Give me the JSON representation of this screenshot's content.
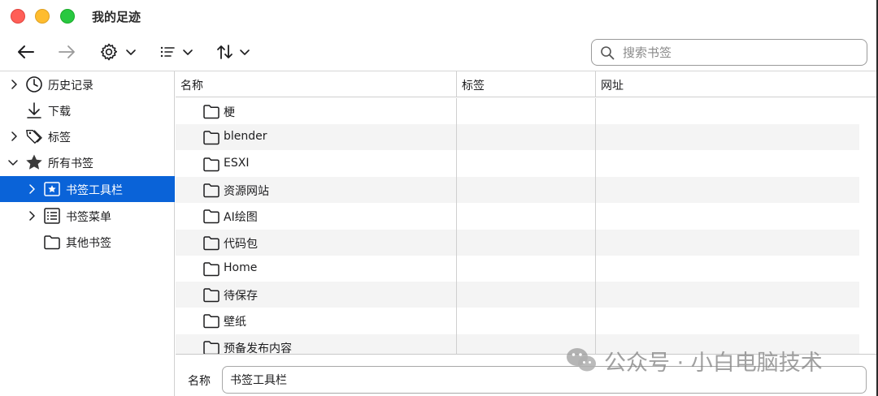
{
  "window": {
    "title": "我的足迹"
  },
  "toolbar": {
    "back_icon": "arrow-left-icon",
    "forward_icon": "arrow-right-icon",
    "organize_icon": "gear-icon",
    "views_icon": "list-icon",
    "sort_icon": "sort-arrows-icon",
    "search_placeholder": "搜索书签"
  },
  "sidebar": {
    "items": [
      {
        "label": "历史记录",
        "icon": "clock-icon",
        "expandable": true,
        "expanded": false,
        "level": 0
      },
      {
        "label": "下载",
        "icon": "download-icon",
        "expandable": false,
        "level": 0
      },
      {
        "label": "标签",
        "icon": "tags-icon",
        "expandable": true,
        "expanded": false,
        "level": 0
      },
      {
        "label": "所有书签",
        "icon": "star-icon",
        "expandable": true,
        "expanded": true,
        "level": 0
      },
      {
        "label": "书签工具栏",
        "icon": "bookmarks-toolbar-icon",
        "expandable": true,
        "expanded": false,
        "level": 1,
        "selected": true
      },
      {
        "label": "书签菜单",
        "icon": "bookmarks-menu-icon",
        "expandable": true,
        "expanded": false,
        "level": 1
      },
      {
        "label": "其他书签",
        "icon": "folder-icon",
        "expandable": false,
        "level": 1
      }
    ]
  },
  "list": {
    "columns": [
      "名称",
      "标签",
      "网址"
    ],
    "rows": [
      {
        "name": "梗",
        "tags": "",
        "url": ""
      },
      {
        "name": "blender",
        "tags": "",
        "url": ""
      },
      {
        "name": "ESXI",
        "tags": "",
        "url": ""
      },
      {
        "name": "资源网站",
        "tags": "",
        "url": ""
      },
      {
        "name": "AI绘图",
        "tags": "",
        "url": ""
      },
      {
        "name": "代码包",
        "tags": "",
        "url": ""
      },
      {
        "name": "Home",
        "tags": "",
        "url": ""
      },
      {
        "name": "待保存",
        "tags": "",
        "url": ""
      },
      {
        "name": "壁纸",
        "tags": "",
        "url": ""
      },
      {
        "name": "预备发布内容",
        "tags": "",
        "url": ""
      }
    ]
  },
  "detail": {
    "name_label": "名称",
    "name_value": "书签工具栏"
  },
  "watermark": {
    "text": "公众号 · 小白电脑技术"
  },
  "colors": {
    "selection": "#0a63d8",
    "row_alt": "#f4f4f4",
    "traffic_red": "#ff5f57",
    "traffic_yellow": "#febc2e",
    "traffic_green": "#28c840"
  }
}
